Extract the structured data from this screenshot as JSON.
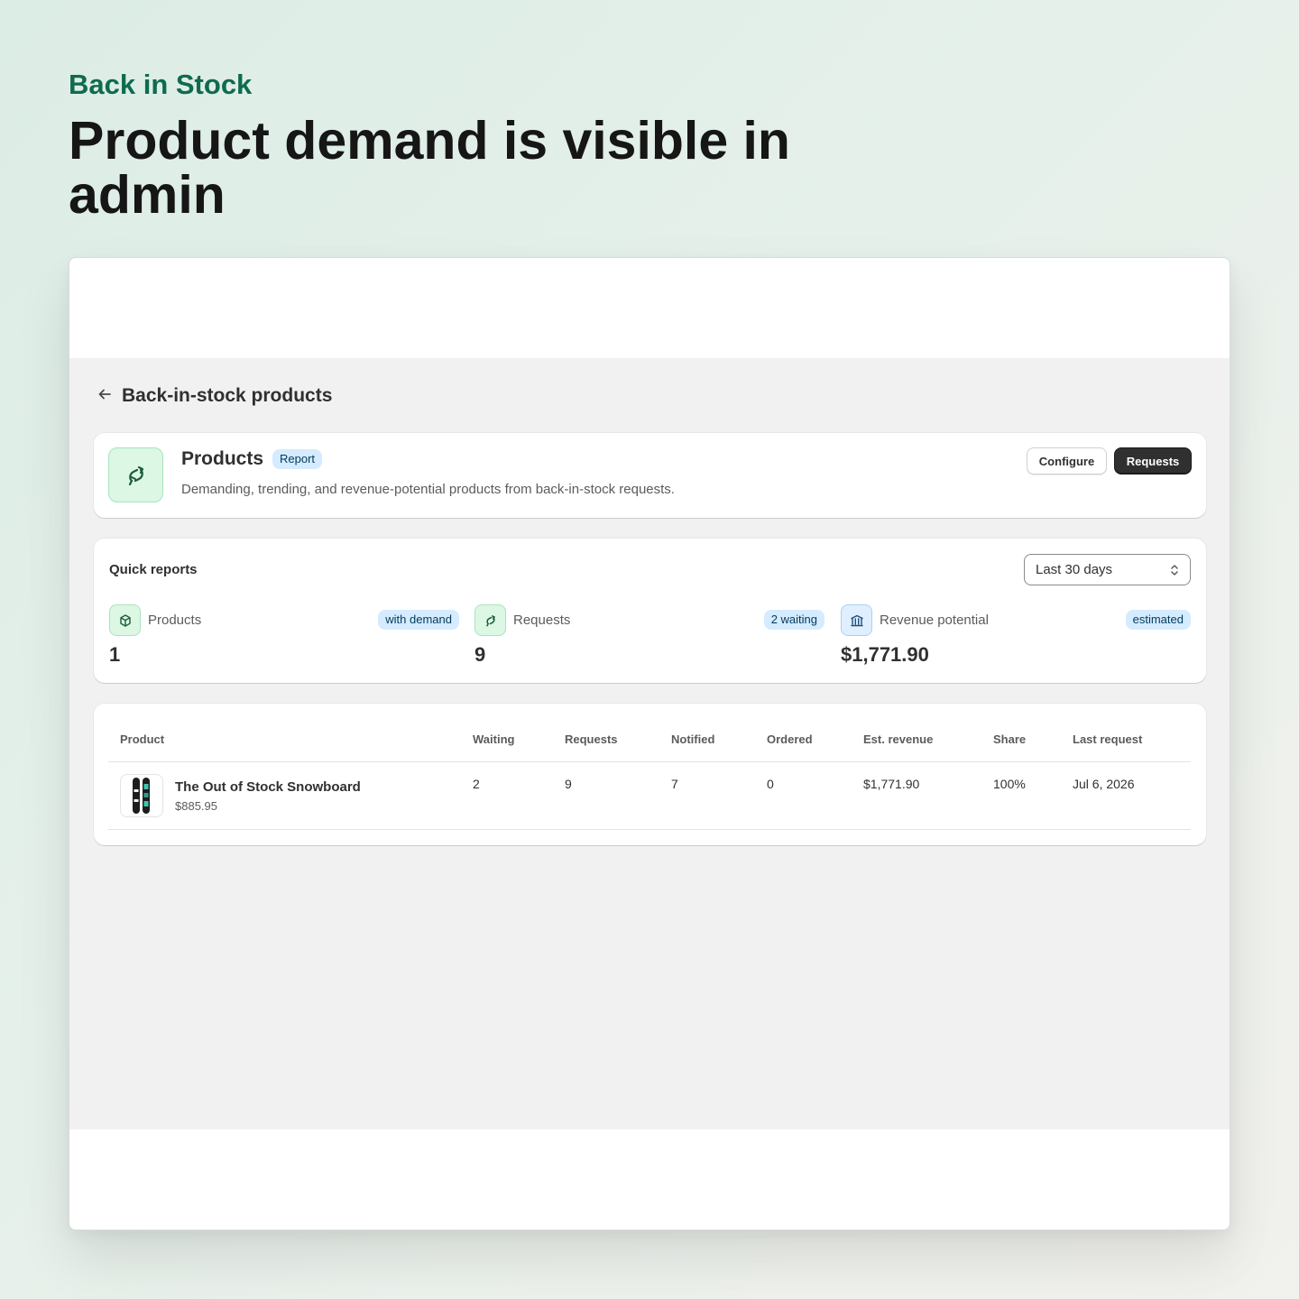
{
  "hero_text": {
    "eyebrow": "Back in Stock",
    "headline": "Product demand is visible in admin"
  },
  "page": {
    "title": "Back-in-stock products",
    "back_icon": "arrow-left-icon"
  },
  "products_card": {
    "icon": "bell-request-icon",
    "title": "Products",
    "badge": "Report",
    "description": "Demanding, trending, and revenue-potential products from back-in-stock requests.",
    "configure_label": "Configure",
    "requests_label": "Requests"
  },
  "quick_reports": {
    "title": "Quick reports",
    "range_select": "Last 30 days",
    "metrics": [
      {
        "label": "Products",
        "badge": "with demand",
        "value": "1",
        "icon": "package-icon"
      },
      {
        "label": "Requests",
        "badge": "2 waiting",
        "value": "9",
        "icon": "bell-request-icon"
      },
      {
        "label": "Revenue potential",
        "badge": "estimated",
        "value": "$1,771.90",
        "icon": "bank-icon"
      }
    ]
  },
  "table": {
    "columns": [
      "Product",
      "Waiting",
      "Requests",
      "Notified",
      "Ordered",
      "Est. revenue",
      "Share",
      "Last request"
    ],
    "rows": [
      {
        "name": "The Out of Stock Snowboard",
        "price": "$885.95",
        "waiting": "2",
        "requests": "9",
        "notified": "7",
        "ordered": "0",
        "est_revenue": "$1,771.90",
        "share": "100%",
        "last_request": "Jul 6, 2026"
      }
    ]
  },
  "colors": {
    "brand_green": "#0f6b4f",
    "icon_green_bg": "#dcf7e4",
    "badge_blue_bg": "#d5ebff",
    "primary_button": "#303030"
  }
}
